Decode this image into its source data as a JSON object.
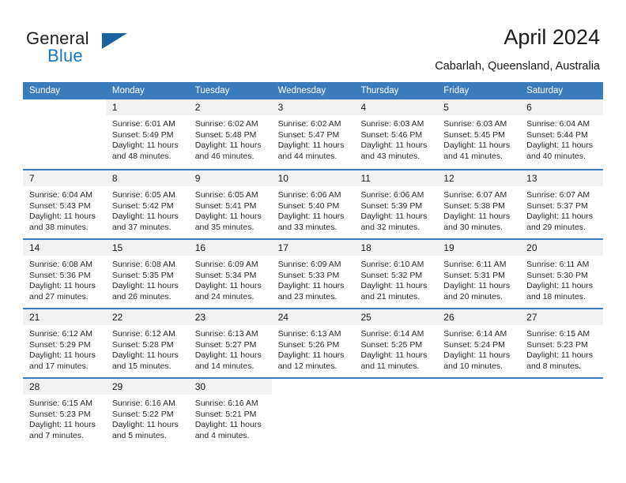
{
  "brand": {
    "name_part1": "General",
    "name_part2": "Blue",
    "accent_color": "#1479bd",
    "triangle_color": "#18639f"
  },
  "header": {
    "title": "April 2024",
    "subtitle": "Cabarlah, Queensland, Australia"
  },
  "calendar": {
    "header_color": "#3a7cbe",
    "day_band_color": "#f2f2f2",
    "day_names": [
      "Sunday",
      "Monday",
      "Tuesday",
      "Wednesday",
      "Thursday",
      "Friday",
      "Saturday"
    ],
    "weeks": [
      {
        "days": [
          {
            "number": "",
            "sunrise": "",
            "sunset": "",
            "daylight_line1": "",
            "daylight_line2": ""
          },
          {
            "number": "1",
            "sunrise": "Sunrise: 6:01 AM",
            "sunset": "Sunset: 5:49 PM",
            "daylight_line1": "Daylight: 11 hours",
            "daylight_line2": "and 48 minutes."
          },
          {
            "number": "2",
            "sunrise": "Sunrise: 6:02 AM",
            "sunset": "Sunset: 5:48 PM",
            "daylight_line1": "Daylight: 11 hours",
            "daylight_line2": "and 46 minutes."
          },
          {
            "number": "3",
            "sunrise": "Sunrise: 6:02 AM",
            "sunset": "Sunset: 5:47 PM",
            "daylight_line1": "Daylight: 11 hours",
            "daylight_line2": "and 44 minutes."
          },
          {
            "number": "4",
            "sunrise": "Sunrise: 6:03 AM",
            "sunset": "Sunset: 5:46 PM",
            "daylight_line1": "Daylight: 11 hours",
            "daylight_line2": "and 43 minutes."
          },
          {
            "number": "5",
            "sunrise": "Sunrise: 6:03 AM",
            "sunset": "Sunset: 5:45 PM",
            "daylight_line1": "Daylight: 11 hours",
            "daylight_line2": "and 41 minutes."
          },
          {
            "number": "6",
            "sunrise": "Sunrise: 6:04 AM",
            "sunset": "Sunset: 5:44 PM",
            "daylight_line1": "Daylight: 11 hours",
            "daylight_line2": "and 40 minutes."
          }
        ]
      },
      {
        "days": [
          {
            "number": "7",
            "sunrise": "Sunrise: 6:04 AM",
            "sunset": "Sunset: 5:43 PM",
            "daylight_line1": "Daylight: 11 hours",
            "daylight_line2": "and 38 minutes."
          },
          {
            "number": "8",
            "sunrise": "Sunrise: 6:05 AM",
            "sunset": "Sunset: 5:42 PM",
            "daylight_line1": "Daylight: 11 hours",
            "daylight_line2": "and 37 minutes."
          },
          {
            "number": "9",
            "sunrise": "Sunrise: 6:05 AM",
            "sunset": "Sunset: 5:41 PM",
            "daylight_line1": "Daylight: 11 hours",
            "daylight_line2": "and 35 minutes."
          },
          {
            "number": "10",
            "sunrise": "Sunrise: 6:06 AM",
            "sunset": "Sunset: 5:40 PM",
            "daylight_line1": "Daylight: 11 hours",
            "daylight_line2": "and 33 minutes."
          },
          {
            "number": "11",
            "sunrise": "Sunrise: 6:06 AM",
            "sunset": "Sunset: 5:39 PM",
            "daylight_line1": "Daylight: 11 hours",
            "daylight_line2": "and 32 minutes."
          },
          {
            "number": "12",
            "sunrise": "Sunrise: 6:07 AM",
            "sunset": "Sunset: 5:38 PM",
            "daylight_line1": "Daylight: 11 hours",
            "daylight_line2": "and 30 minutes."
          },
          {
            "number": "13",
            "sunrise": "Sunrise: 6:07 AM",
            "sunset": "Sunset: 5:37 PM",
            "daylight_line1": "Daylight: 11 hours",
            "daylight_line2": "and 29 minutes."
          }
        ]
      },
      {
        "days": [
          {
            "number": "14",
            "sunrise": "Sunrise: 6:08 AM",
            "sunset": "Sunset: 5:36 PM",
            "daylight_line1": "Daylight: 11 hours",
            "daylight_line2": "and 27 minutes."
          },
          {
            "number": "15",
            "sunrise": "Sunrise: 6:08 AM",
            "sunset": "Sunset: 5:35 PM",
            "daylight_line1": "Daylight: 11 hours",
            "daylight_line2": "and 26 minutes."
          },
          {
            "number": "16",
            "sunrise": "Sunrise: 6:09 AM",
            "sunset": "Sunset: 5:34 PM",
            "daylight_line1": "Daylight: 11 hours",
            "daylight_line2": "and 24 minutes."
          },
          {
            "number": "17",
            "sunrise": "Sunrise: 6:09 AM",
            "sunset": "Sunset: 5:33 PM",
            "daylight_line1": "Daylight: 11 hours",
            "daylight_line2": "and 23 minutes."
          },
          {
            "number": "18",
            "sunrise": "Sunrise: 6:10 AM",
            "sunset": "Sunset: 5:32 PM",
            "daylight_line1": "Daylight: 11 hours",
            "daylight_line2": "and 21 minutes."
          },
          {
            "number": "19",
            "sunrise": "Sunrise: 6:11 AM",
            "sunset": "Sunset: 5:31 PM",
            "daylight_line1": "Daylight: 11 hours",
            "daylight_line2": "and 20 minutes."
          },
          {
            "number": "20",
            "sunrise": "Sunrise: 6:11 AM",
            "sunset": "Sunset: 5:30 PM",
            "daylight_line1": "Daylight: 11 hours",
            "daylight_line2": "and 18 minutes."
          }
        ]
      },
      {
        "days": [
          {
            "number": "21",
            "sunrise": "Sunrise: 6:12 AM",
            "sunset": "Sunset: 5:29 PM",
            "daylight_line1": "Daylight: 11 hours",
            "daylight_line2": "and 17 minutes."
          },
          {
            "number": "22",
            "sunrise": "Sunrise: 6:12 AM",
            "sunset": "Sunset: 5:28 PM",
            "daylight_line1": "Daylight: 11 hours",
            "daylight_line2": "and 15 minutes."
          },
          {
            "number": "23",
            "sunrise": "Sunrise: 6:13 AM",
            "sunset": "Sunset: 5:27 PM",
            "daylight_line1": "Daylight: 11 hours",
            "daylight_line2": "and 14 minutes."
          },
          {
            "number": "24",
            "sunrise": "Sunrise: 6:13 AM",
            "sunset": "Sunset: 5:26 PM",
            "daylight_line1": "Daylight: 11 hours",
            "daylight_line2": "and 12 minutes."
          },
          {
            "number": "25",
            "sunrise": "Sunrise: 6:14 AM",
            "sunset": "Sunset: 5:25 PM",
            "daylight_line1": "Daylight: 11 hours",
            "daylight_line2": "and 11 minutes."
          },
          {
            "number": "26",
            "sunrise": "Sunrise: 6:14 AM",
            "sunset": "Sunset: 5:24 PM",
            "daylight_line1": "Daylight: 11 hours",
            "daylight_line2": "and 10 minutes."
          },
          {
            "number": "27",
            "sunrise": "Sunrise: 6:15 AM",
            "sunset": "Sunset: 5:23 PM",
            "daylight_line1": "Daylight: 11 hours",
            "daylight_line2": "and 8 minutes."
          }
        ]
      },
      {
        "days": [
          {
            "number": "28",
            "sunrise": "Sunrise: 6:15 AM",
            "sunset": "Sunset: 5:23 PM",
            "daylight_line1": "Daylight: 11 hours",
            "daylight_line2": "and 7 minutes."
          },
          {
            "number": "29",
            "sunrise": "Sunrise: 6:16 AM",
            "sunset": "Sunset: 5:22 PM",
            "daylight_line1": "Daylight: 11 hours",
            "daylight_line2": "and 5 minutes."
          },
          {
            "number": "30",
            "sunrise": "Sunrise: 6:16 AM",
            "sunset": "Sunset: 5:21 PM",
            "daylight_line1": "Daylight: 11 hours",
            "daylight_line2": "and 4 minutes."
          },
          {
            "number": "",
            "sunrise": "",
            "sunset": "",
            "daylight_line1": "",
            "daylight_line2": ""
          },
          {
            "number": "",
            "sunrise": "",
            "sunset": "",
            "daylight_line1": "",
            "daylight_line2": ""
          },
          {
            "number": "",
            "sunrise": "",
            "sunset": "",
            "daylight_line1": "",
            "daylight_line2": ""
          },
          {
            "number": "",
            "sunrise": "",
            "sunset": "",
            "daylight_line1": "",
            "daylight_line2": ""
          }
        ]
      }
    ]
  }
}
